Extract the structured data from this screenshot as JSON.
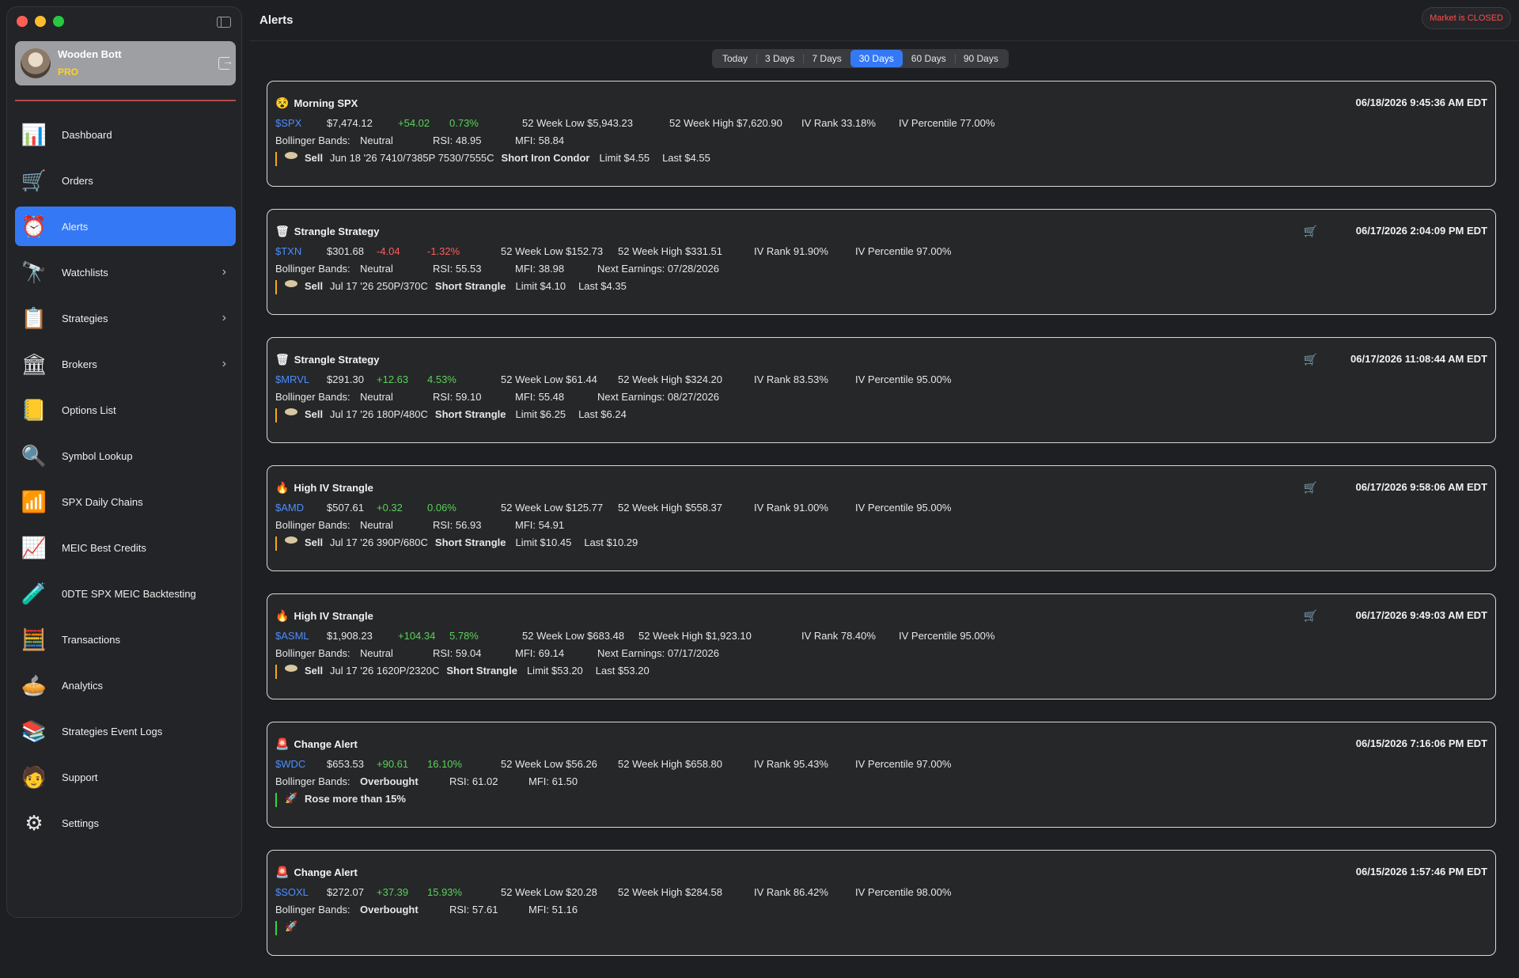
{
  "sidebar": {
    "profile": {
      "name": "Wooden Bott",
      "tier": "PRO"
    },
    "items": [
      {
        "label": "Dashboard",
        "icon": "dashboard-icon",
        "glyph": "📊"
      },
      {
        "label": "Orders",
        "icon": "cart-icon",
        "glyph": "🛒"
      },
      {
        "label": "Alerts",
        "icon": "alarm-clock-icon",
        "glyph": "⏰"
      },
      {
        "label": "Watchlists",
        "icon": "watchlist-icon",
        "glyph": "🔭"
      },
      {
        "label": "Strategies",
        "icon": "strategies-icon",
        "glyph": "📋"
      },
      {
        "label": "Brokers",
        "icon": "bank-icon",
        "glyph": "🏛"
      },
      {
        "label": "Options List",
        "icon": "list-icon",
        "glyph": "📒"
      },
      {
        "label": "Symbol Lookup",
        "icon": "magnifier-icon",
        "glyph": "🔍"
      },
      {
        "label": "SPX Daily Chains",
        "icon": "bar-chart-icon",
        "glyph": "📶"
      },
      {
        "label": "MEIC Best Credits",
        "icon": "chart-dollar-icon",
        "glyph": "📈"
      },
      {
        "label": "0DTE SPX MEIC Backtesting",
        "icon": "flask-icon",
        "glyph": "🧪"
      },
      {
        "label": "Transactions",
        "icon": "calculator-icon",
        "glyph": "🧮"
      },
      {
        "label": "Analytics",
        "icon": "pie-chart-icon",
        "glyph": "🥧"
      },
      {
        "label": "Strategies Event Logs",
        "icon": "binders-icon",
        "glyph": "📚"
      },
      {
        "label": "Support",
        "icon": "support-agent-icon",
        "glyph": "🧑"
      },
      {
        "label": "Settings",
        "icon": "gears-icon",
        "glyph": "⚙"
      }
    ],
    "active_index": 2
  },
  "header": {
    "title": "Alerts",
    "market_status": "Market is CLOSED"
  },
  "filters": {
    "options": [
      "Today",
      "3 Days",
      "7 Days",
      "30 Days",
      "60 Days",
      "90 Days"
    ],
    "selected": "30 Days"
  },
  "alerts": [
    {
      "icon": "😵",
      "icon_name": "emoji-icon",
      "title": "Morning SPX",
      "date": "06/18/2026 9:45:36 AM EDT",
      "cart": false,
      "ticker": "$SPX",
      "price": "$7,474.12",
      "change": "+54.02",
      "change_pct": "0.73%",
      "dir": "pos",
      "low": "52 Week Low $5,943.23",
      "high": "52 Week High $7,620.90",
      "iv_rank": "IV Rank 33.18%",
      "iv_pct": "IV Percentile 77.00%",
      "bb_label": "Bollinger Bands:",
      "bb": "Neutral",
      "bb_bold": false,
      "rsi": "RSI:  48.95",
      "mfi": "MFI:  58.84",
      "earnings": "",
      "action": "Sell",
      "contract": "Jun 18 '26  7410/7385P 7530/7555C",
      "strategy": "Short Iron Condor",
      "limit": "Limit $4.55",
      "last": "Last $4.55",
      "bar": "orange"
    },
    {
      "icon": "🗑",
      "icon_name": "strategy-icon",
      "title": "Strangle Strategy",
      "date": "06/17/2026 2:04:09 PM EDT",
      "cart": true,
      "ticker": "$TXN",
      "price": "$301.68",
      "change": "-4.04",
      "change_pct": "-1.32%",
      "dir": "neg",
      "low": "52 Week Low $152.73",
      "high": "52 Week High $331.51",
      "iv_rank": "IV Rank 91.90%",
      "iv_pct": "IV Percentile 97.00%",
      "bb_label": "Bollinger Bands:",
      "bb": "Neutral",
      "bb_bold": false,
      "rsi": "RSI:  55.53",
      "mfi": "MFI:  38.98",
      "earnings": "Next Earnings: 07/28/2026",
      "action": "Sell",
      "contract": "Jul 17 '26  250P/370C",
      "strategy": "Short Strangle",
      "limit": "Limit $4.10",
      "last": "Last $4.35",
      "bar": "orange"
    },
    {
      "icon": "🗑",
      "icon_name": "strategy-icon",
      "title": "Strangle Strategy",
      "date": "06/17/2026 11:08:44 AM EDT",
      "cart": true,
      "ticker": "$MRVL",
      "price": "$291.30",
      "change": "+12.63",
      "change_pct": "4.53%",
      "dir": "pos",
      "low": "52 Week Low $61.44",
      "high": "52 Week High $324.20",
      "iv_rank": "IV Rank 83.53%",
      "iv_pct": "IV Percentile 95.00%",
      "bb_label": "Bollinger Bands:",
      "bb": "Neutral",
      "bb_bold": false,
      "rsi": "RSI:  59.10",
      "mfi": "MFI:  55.48",
      "earnings": "Next Earnings: 08/27/2026",
      "action": "Sell",
      "contract": "Jul 17 '26  180P/480C",
      "strategy": "Short Strangle",
      "limit": "Limit $6.25",
      "last": "Last $6.24",
      "bar": "orange"
    },
    {
      "icon": "🔥",
      "icon_name": "fire-icon",
      "title": "High IV Strangle",
      "date": "06/17/2026 9:58:06 AM EDT",
      "cart": true,
      "ticker": "$AMD",
      "price": "$507.61",
      "change": "+0.32",
      "change_pct": "0.06%",
      "dir": "pos",
      "low": "52 Week Low $125.77",
      "high": "52 Week High $558.37",
      "iv_rank": "IV Rank 91.00%",
      "iv_pct": "IV Percentile 95.00%",
      "bb_label": "Bollinger Bands:",
      "bb": "Neutral",
      "bb_bold": false,
      "rsi": "RSI:  56.93",
      "mfi": "MFI:  54.91",
      "earnings": "",
      "action": "Sell",
      "contract": "Jul 17 '26  390P/680C",
      "strategy": "Short Strangle",
      "limit": "Limit $10.45",
      "last": "Last $10.29",
      "bar": "orange"
    },
    {
      "icon": "🔥",
      "icon_name": "fire-icon",
      "title": "High IV Strangle",
      "date": "06/17/2026 9:49:03 AM EDT",
      "cart": true,
      "ticker": "$ASML",
      "price": "$1,908.23",
      "change": "+104.34",
      "change_pct": "5.78%",
      "dir": "pos",
      "low": "52 Week Low $683.48",
      "high": "52 Week High $1,923.10",
      "iv_rank": "IV Rank 78.40%",
      "iv_pct": "IV Percentile 95.00%",
      "bb_label": "Bollinger Bands:",
      "bb": "Neutral",
      "bb_bold": false,
      "rsi": "RSI:  59.04",
      "mfi": "MFI:  69.14",
      "earnings": "Next Earnings: 07/17/2026",
      "action": "Sell",
      "contract": "Jul 17 '26  1620P/2320C",
      "strategy": "Short Strangle",
      "limit": "Limit $53.20",
      "last": "Last $53.20",
      "bar": "orange"
    },
    {
      "icon": "🚨",
      "icon_name": "siren-icon",
      "title": "Change Alert",
      "date": "06/15/2026 7:16:06 PM EDT",
      "cart": false,
      "ticker": "$WDC",
      "price": "$653.53",
      "change": "+90.61",
      "change_pct": "16.10%",
      "dir": "pos",
      "low": "52 Week Low $56.26",
      "high": "52 Week High $658.80",
      "iv_rank": "IV Rank 95.43%",
      "iv_pct": "IV Percentile 97.00%",
      "bb_label": "Bollinger Bands:",
      "bb": "Overbought",
      "bb_bold": true,
      "rsi": "RSI:  61.02",
      "mfi": "MFI:  61.50",
      "earnings": "",
      "message": "Rose more than 15%",
      "bar": "green"
    },
    {
      "icon": "🚨",
      "icon_name": "siren-icon",
      "title": "Change Alert",
      "date": "06/15/2026 1:57:46 PM EDT",
      "cart": false,
      "ticker": "$SOXL",
      "price": "$272.07",
      "change": "+37.39",
      "change_pct": "15.93%",
      "dir": "pos",
      "low": "52 Week Low $20.28",
      "high": "52 Week High $284.58",
      "iv_rank": "IV Rank 86.42%",
      "iv_pct": "IV Percentile 98.00%",
      "bb_label": "Bollinger Bands:",
      "bb": "Overbought",
      "bb_bold": true,
      "rsi": "RSI:  57.61",
      "mfi": "MFI:  51.16",
      "earnings": "",
      "message": "",
      "bar": "green"
    }
  ]
}
